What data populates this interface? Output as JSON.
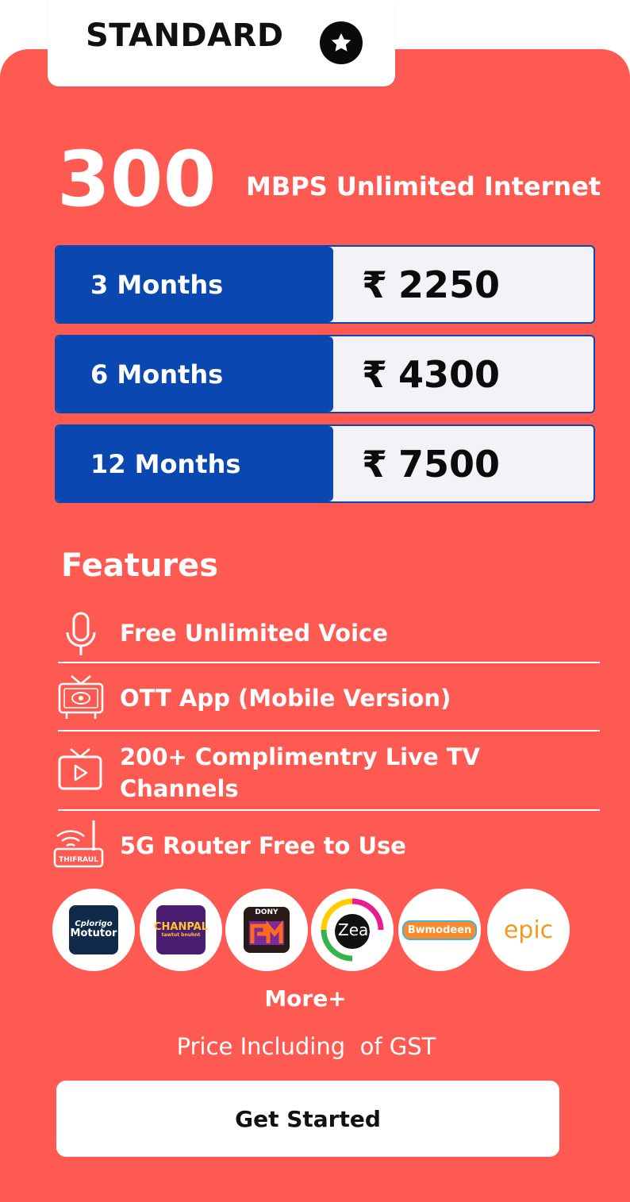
{
  "plan": {
    "name": "STANDARD",
    "speed_value": "300",
    "speed_label": "MBPS Unlimited Internet"
  },
  "pricing": [
    {
      "duration": "3 Months",
      "currency": "₹",
      "amount": "2250"
    },
    {
      "duration": "6 Months",
      "currency": "₹",
      "amount": "4300"
    },
    {
      "duration": "12 Months",
      "currency": "₹",
      "amount": "7500"
    }
  ],
  "features": {
    "title": "Features",
    "items": [
      {
        "icon": "microphone-icon",
        "label": "Free Unlimited Voice"
      },
      {
        "icon": "ott-tv-icon",
        "label": "OTT App (Mobile Version)"
      },
      {
        "icon": "live-tv-icon",
        "label": "200+ Complimentry Live TV Channels"
      },
      {
        "icon": "router-icon",
        "label": "5G Router Free to Use",
        "icon_text": "THIFRAUL"
      }
    ]
  },
  "channel_logos": [
    {
      "name": "Cplorigo Motutor",
      "line1": "Cplorigo",
      "line2": "Motutor",
      "bg": "#0e2a48"
    },
    {
      "name": "CHANPAL",
      "line1": "CHANPAL",
      "line2": "tawtut bnuhnt",
      "bg": "#4a1d70"
    },
    {
      "name": "DONY",
      "line1": "DONY",
      "bg": "#2a1a1a"
    },
    {
      "name": "Zeas",
      "line1": "Zeas"
    },
    {
      "name": "Bwmodeen",
      "line1": "Bwmodeen"
    },
    {
      "name": "epic",
      "line1": "epic"
    }
  ],
  "more_label": "More+",
  "gst_note": "Price Including  of GST",
  "cta": {
    "label": "Get Started"
  },
  "colors": {
    "card_bg": "#ff5a52",
    "duration_bg": "#0a47b0",
    "price_bg": "#f3f2f7",
    "star_badge": "#0a0a0a"
  }
}
